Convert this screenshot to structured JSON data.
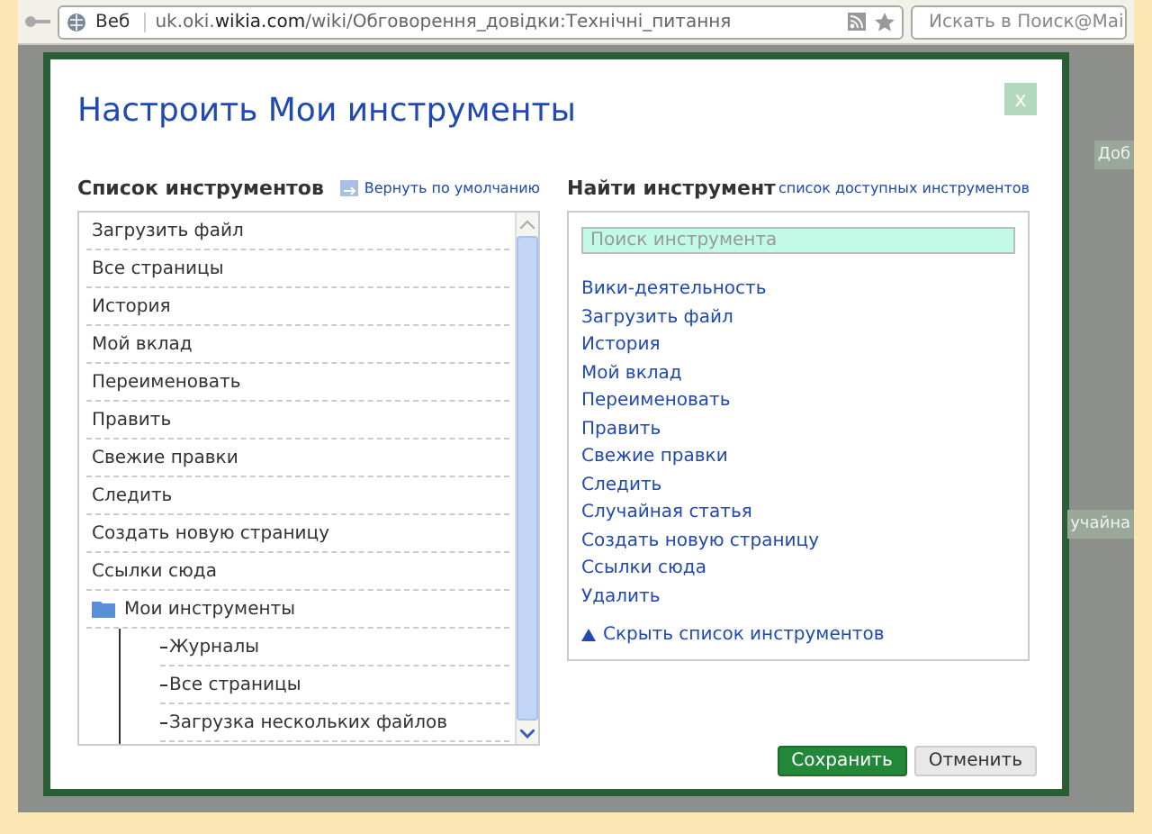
{
  "browser": {
    "mode_label": "Веб",
    "url_prefix": "uk.oki.",
    "url_domain": "wikia.com",
    "url_path": "/wiki/Обговорення_довідки:Технічні_питання",
    "search_placeholder": "Искать в Поиск@Mai"
  },
  "background": {
    "button_left": "Доб",
    "button_right": "учайна"
  },
  "dialog": {
    "title": "Настроить Мои инструменты",
    "close": "x",
    "left": {
      "heading": "Список инструментов",
      "reset_link": "Вернуть по умолчанию",
      "items": [
        {
          "label": "Загрузить файл",
          "kind": "item"
        },
        {
          "label": "Все страницы",
          "kind": "item"
        },
        {
          "label": "История",
          "kind": "item"
        },
        {
          "label": "Мой вклад",
          "kind": "item"
        },
        {
          "label": "Переименовать",
          "kind": "item"
        },
        {
          "label": "Править",
          "kind": "item"
        },
        {
          "label": "Свежие правки",
          "kind": "item"
        },
        {
          "label": "Следить",
          "kind": "item"
        },
        {
          "label": "Создать новую страницу",
          "kind": "item"
        },
        {
          "label": "Ссылки сюда",
          "kind": "item"
        },
        {
          "label": "Мои инструменты",
          "kind": "folder",
          "children": [
            {
              "label": "Журналы"
            },
            {
              "label": "Все страницы"
            },
            {
              "label": "Загрузка нескольких файлов"
            }
          ]
        }
      ]
    },
    "right": {
      "heading": "Найти инструмент",
      "list_link": "список доступных инструментов",
      "search_placeholder": "Поиск инструмента",
      "tools": [
        "Вики-деятельность",
        "Загрузить файл",
        "История",
        "Мой вклад",
        "Переименовать",
        "Править",
        "Свежие правки",
        "Следить",
        "Случайная статья",
        "Создать новую страницу",
        "Ссылки сюда",
        "Удалить"
      ],
      "toggle": {
        "label": "Скрыть список инструментов",
        "expanded": true
      }
    },
    "buttons": [
      {
        "label": "Сохранить",
        "kind": "primary"
      },
      {
        "label": "Отменить",
        "kind": "secondary"
      }
    ]
  }
}
